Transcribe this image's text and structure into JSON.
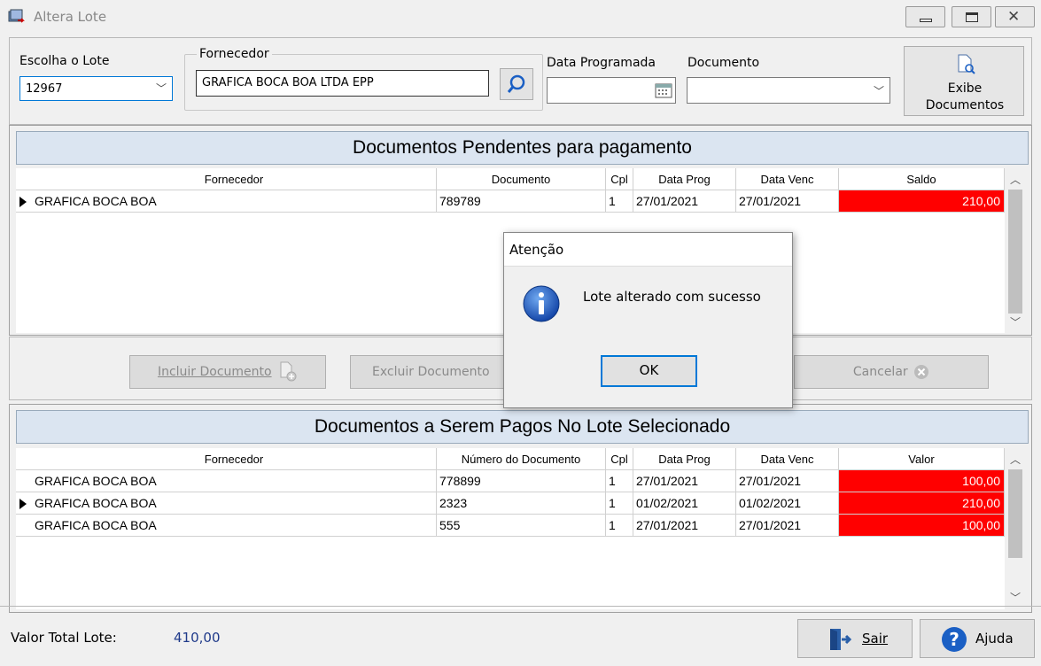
{
  "window": {
    "title": "Altera Lote"
  },
  "top": {
    "lote_label": "Escolha o Lote",
    "lote_value": "12967",
    "fornecedor_label": "Fornecedor",
    "fornecedor_value": "GRAFICA BOCA BOA LTDA EPP",
    "data_label": "Data Programada",
    "data_value": "",
    "documento_label": "Documento",
    "documento_value": "",
    "exibe_label": "Exibe Documentos"
  },
  "pendentes": {
    "title": "Documentos Pendentes para pagamento",
    "columns": [
      "Fornecedor",
      "Documento",
      "Cpl",
      "Data Prog",
      "Data Venc",
      "Saldo"
    ],
    "rows": [
      {
        "fornecedor": "GRAFICA BOCA BOA",
        "documento": "789789",
        "cpl": "1",
        "data_prog": "27/01/2021",
        "data_venc": "27/01/2021",
        "saldo": "210,00",
        "current": true
      }
    ]
  },
  "actions": {
    "incluir": "Incluir Documento",
    "excluir": "Excluir Documento",
    "cancelar": "Cancelar"
  },
  "pagos": {
    "title": "Documentos a Serem Pagos No Lote Selecionado",
    "columns": [
      "Fornecedor",
      "Número do Documento",
      "Cpl",
      "Data Prog",
      "Data Venc",
      "Valor"
    ],
    "rows": [
      {
        "fornecedor": "GRAFICA BOCA BOA",
        "documento": "778899",
        "cpl": "1",
        "data_prog": "27/01/2021",
        "data_venc": "27/01/2021",
        "valor": "100,00",
        "current": false
      },
      {
        "fornecedor": "GRAFICA BOCA BOA",
        "documento": "2323",
        "cpl": "1",
        "data_prog": "01/02/2021",
        "data_venc": "01/02/2021",
        "valor": "210,00",
        "current": true
      },
      {
        "fornecedor": "GRAFICA BOCA BOA",
        "documento": "555",
        "cpl": "1",
        "data_prog": "27/01/2021",
        "data_venc": "27/01/2021",
        "valor": "100,00",
        "current": false
      }
    ]
  },
  "status": {
    "total_label": "Valor Total Lote:",
    "total_value": "410,00",
    "sair": "Sair",
    "ajuda": "Ajuda"
  },
  "dialog": {
    "title": "Atenção",
    "message": "Lote alterado com sucesso",
    "ok": "OK"
  },
  "colors": {
    "saldo_bg": "#ff0000",
    "header_bar": "#dbe5f1",
    "info_blue": "#1a5fc4"
  }
}
